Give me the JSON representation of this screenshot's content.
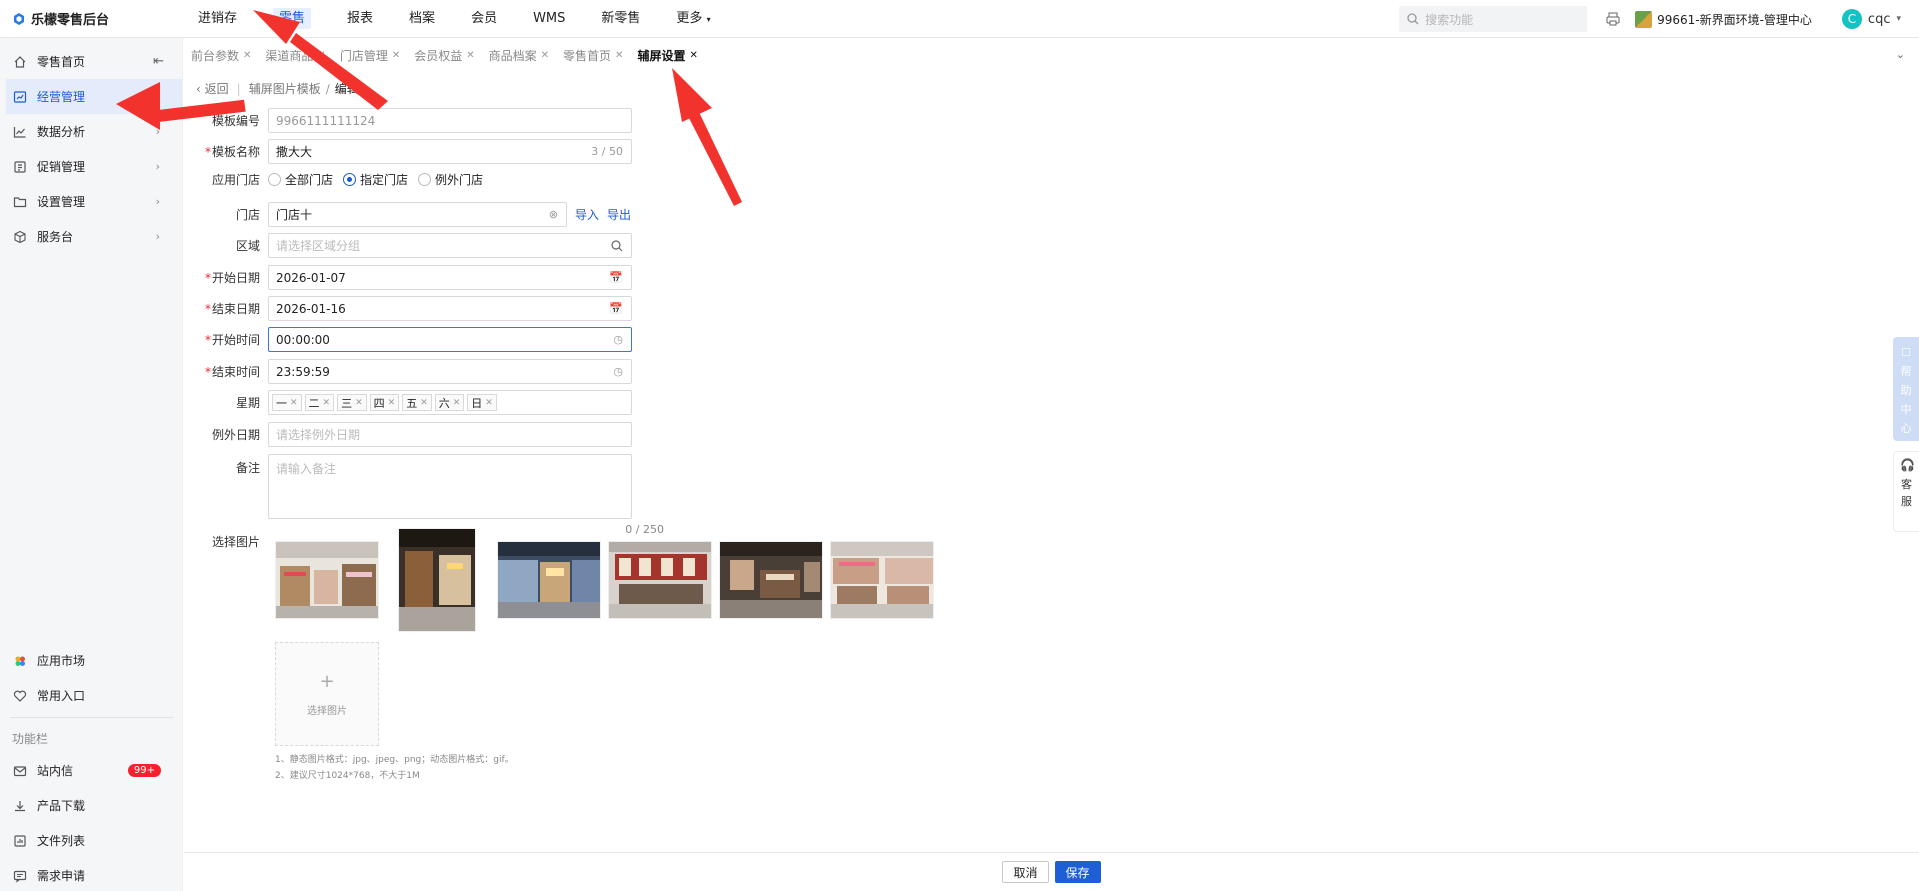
{
  "app": {
    "title": "乐檬零售后台"
  },
  "topnav": [
    "进销存",
    "零售",
    "报表",
    "档案",
    "会员",
    "WMS",
    "新零售",
    "更多"
  ],
  "topnav_active": "零售",
  "search": {
    "placeholder": "搜索功能"
  },
  "store": {
    "label": "99661-新界面环境-管理中心"
  },
  "user": {
    "avatar_letter": "C",
    "name": "cqc"
  },
  "sidebar": {
    "items": [
      {
        "label": "零售首页",
        "icon": "home-icon"
      },
      {
        "label": "经营管理",
        "icon": "chart-board-icon"
      },
      {
        "label": "数据分析",
        "icon": "line-chart-icon"
      },
      {
        "label": "促销管理",
        "icon": "promotion-icon"
      },
      {
        "label": "设置管理",
        "icon": "folder-icon"
      },
      {
        "label": "服务台",
        "icon": "cube-icon"
      }
    ],
    "bottom_items": [
      {
        "label": "应用市场",
        "icon": "app-market-icon"
      },
      {
        "label": "常用入口",
        "icon": "heart-icon"
      }
    ],
    "group_title": "功能栏",
    "tool_items": [
      {
        "label": "站内信",
        "icon": "mail-icon",
        "badge": "99+"
      },
      {
        "label": "产品下载",
        "icon": "download-icon"
      },
      {
        "label": "文件列表",
        "icon": "file-list-icon"
      },
      {
        "label": "需求申请",
        "icon": "request-icon"
      }
    ]
  },
  "tabs": [
    "前台参数",
    "渠道商品",
    "门店管理",
    "会员权益",
    "商品档案",
    "零售首页",
    "辅屏设置"
  ],
  "breadcrumb": {
    "back": "返回",
    "parent": "辅屏图片模板",
    "current": "编辑"
  },
  "form": {
    "template_no": {
      "label": "模板编号",
      "value": "9966111111124"
    },
    "template_name": {
      "label": "模板名称",
      "value": "撒大大",
      "count": "3 / 50"
    },
    "apply_store": {
      "label": "应用门店",
      "options": [
        "全部门店",
        "指定门店",
        "例外门店"
      ],
      "selected": "指定门店"
    },
    "store": {
      "label": "门店",
      "value": "门店十",
      "import": "导入",
      "export": "导出"
    },
    "region": {
      "label": "区域",
      "placeholder": "请选择区域分组"
    },
    "start_date": {
      "label": "开始日期",
      "value": "2026-01-07"
    },
    "end_date": {
      "label": "结束日期",
      "value": "2026-01-16"
    },
    "start_time": {
      "label": "开始时间",
      "value": "00:00:00"
    },
    "end_time": {
      "label": "结束时间",
      "value": "23:59:59"
    },
    "weekday": {
      "label": "星期",
      "tags": [
        "一",
        "二",
        "三",
        "四",
        "五",
        "六",
        "日"
      ]
    },
    "except_date": {
      "label": "例外日期",
      "placeholder": "请选择例外日期"
    },
    "remark": {
      "label": "备注",
      "placeholder": "请输入备注",
      "count": "0 / 250"
    },
    "images": {
      "label": "选择图片",
      "upload_text": "选择图片"
    },
    "hints": [
      "1、静态图片格式：jpg、jpeg、png；动态图片格式：gif。",
      "2、建议尺寸1024*768，不大于1M"
    ]
  },
  "footer": {
    "cancel": "取消",
    "save": "保存"
  },
  "floats": {
    "help": [
      "帮",
      "助",
      "中",
      "心"
    ],
    "service": [
      "客",
      "服"
    ]
  },
  "colors": {
    "accent": "#1a5cd6",
    "required": "#f5222d",
    "annotation_arrow": "#f2322d"
  }
}
